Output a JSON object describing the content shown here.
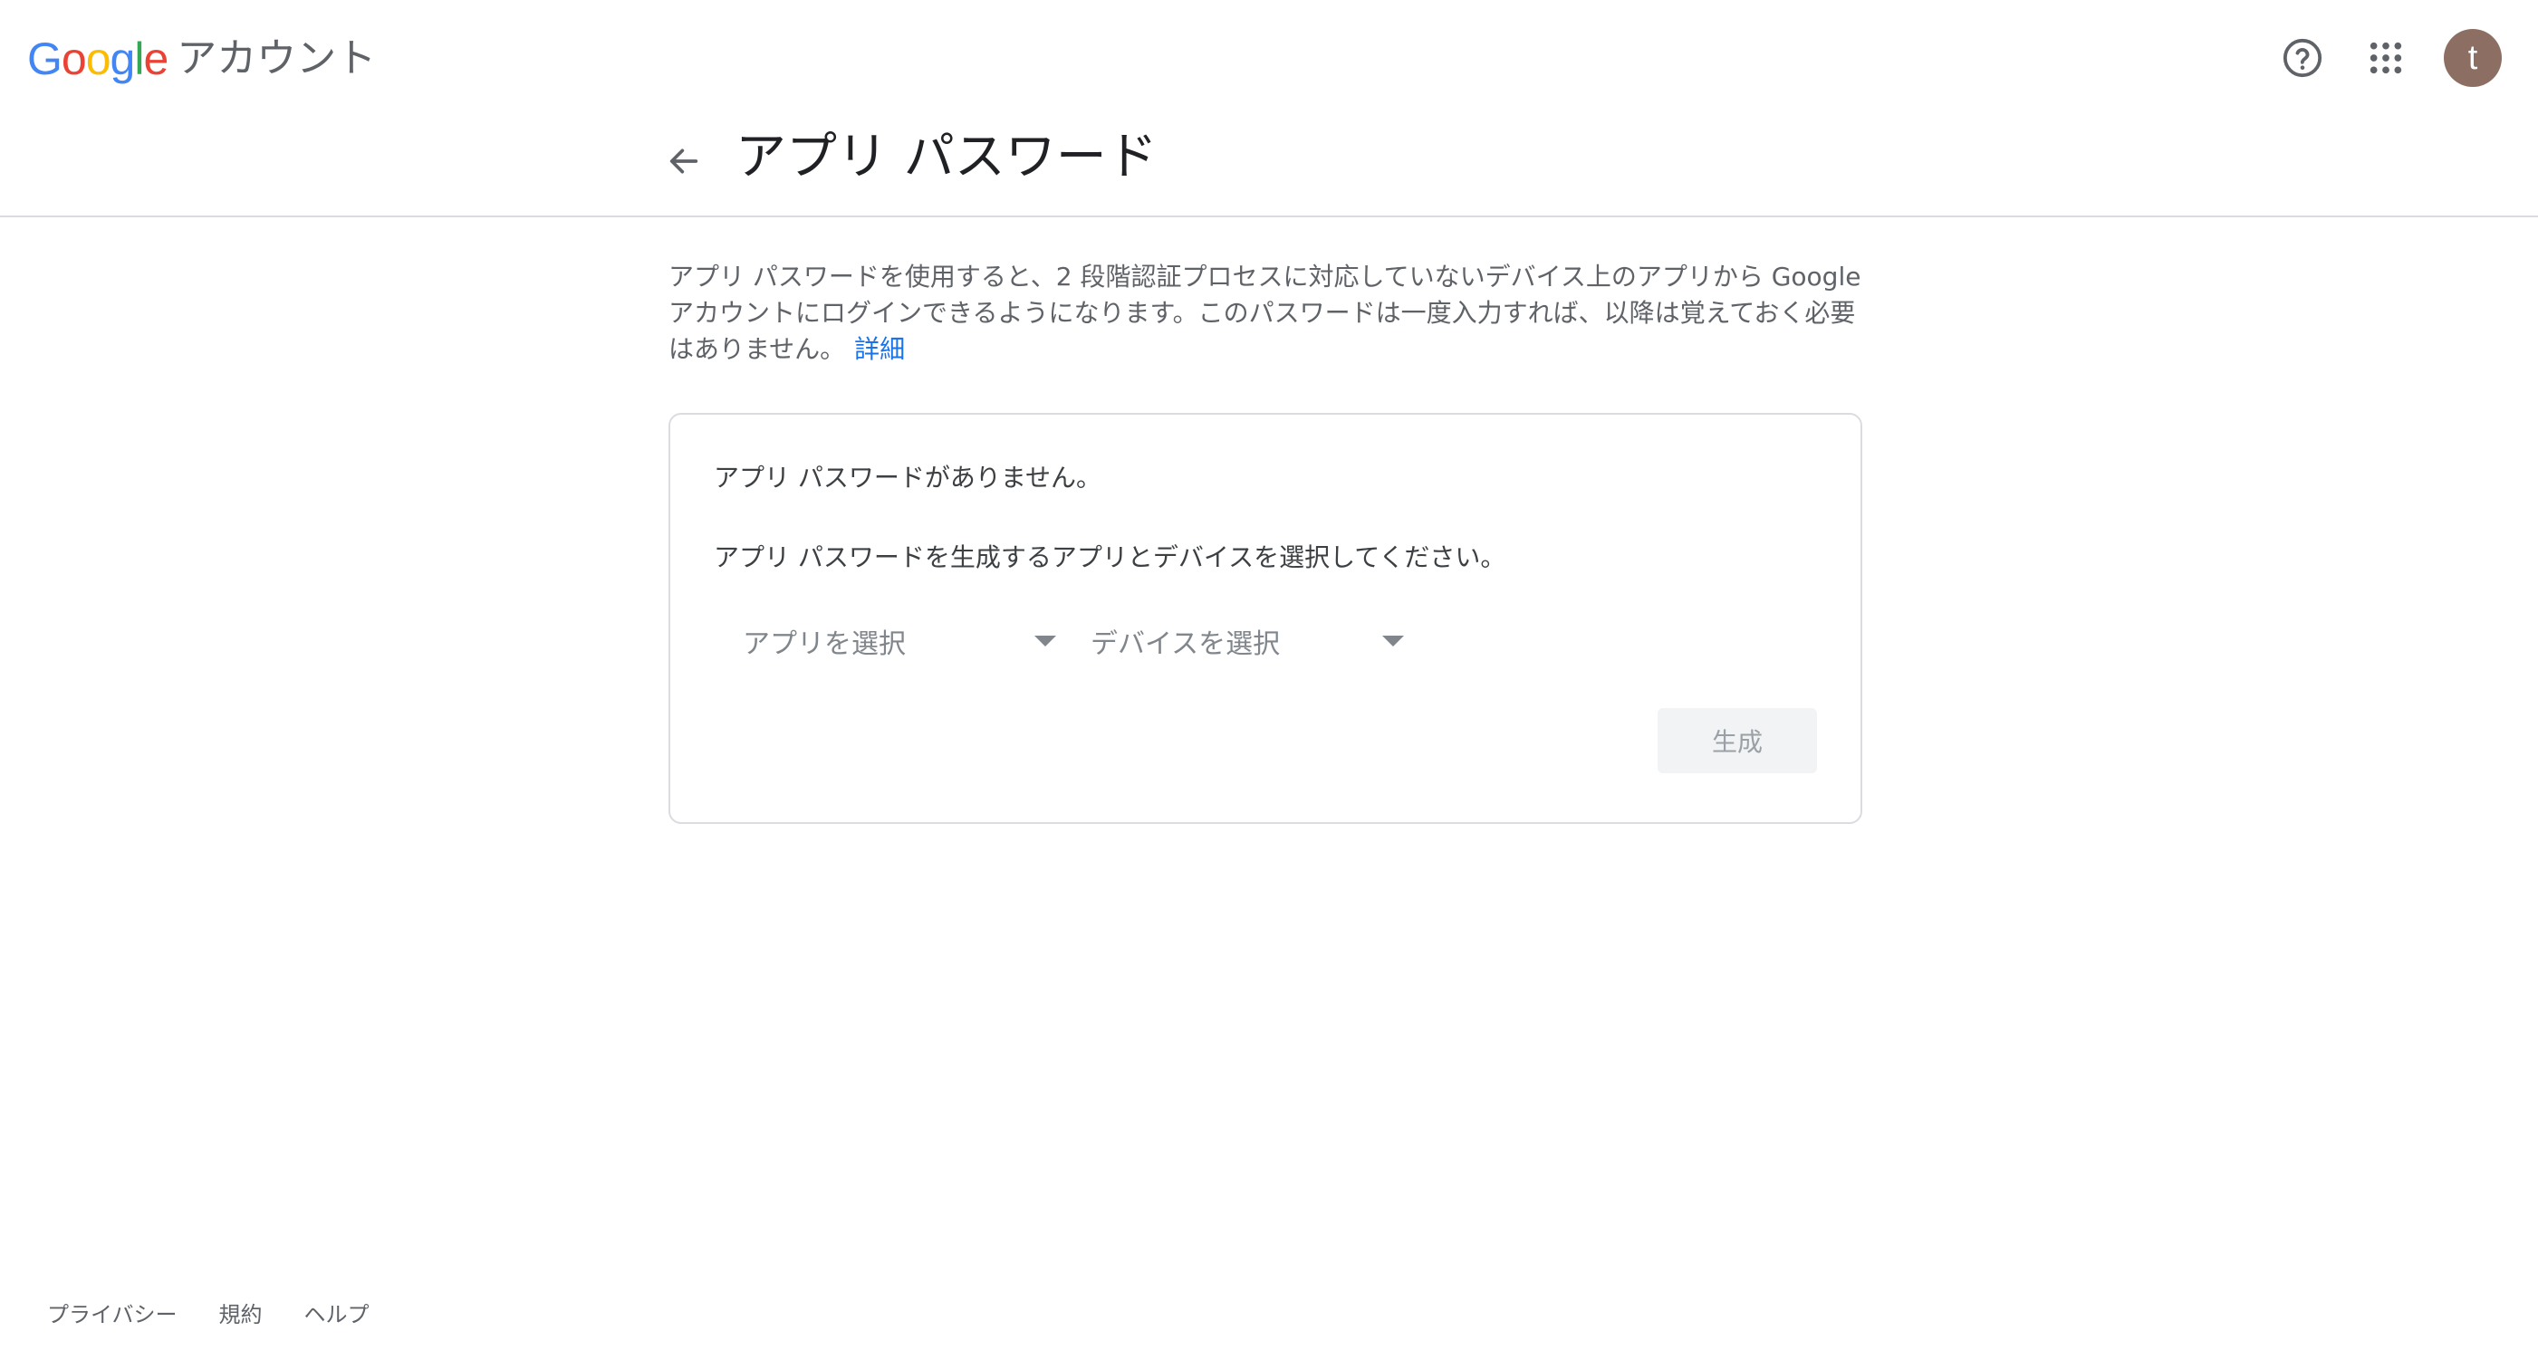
{
  "header": {
    "logo_parts": [
      {
        "text": "G",
        "color": "#4285F4"
      },
      {
        "text": "o",
        "color": "#EA4335"
      },
      {
        "text": "o",
        "color": "#FBBC05"
      },
      {
        "text": "g",
        "color": "#4285F4"
      },
      {
        "text": "l",
        "color": "#34A853"
      },
      {
        "text": "e",
        "color": "#EA4335"
      }
    ],
    "product": "アカウント",
    "help_icon": "help-circle-icon",
    "apps_icon": "apps-grid-icon",
    "avatar_initial": "t",
    "avatar_color": "#8d6e63"
  },
  "page": {
    "title": "アプリ パスワード",
    "back_icon": "arrow-back-icon",
    "description": "アプリ パスワードを使用すると、2 段階認証プロセスに対応していないデバイス上のアプリから Google アカウントにログインできるようになります。このパスワードは一度入力すれば、以降は覚えておく必要はありません。",
    "learn_more": "詳細"
  },
  "card": {
    "no_passwords": "アプリ パスワードがありません。",
    "instruction": "アプリ パスワードを生成するアプリとデバイスを選択してください。",
    "app_select": {
      "label": "アプリを選択"
    },
    "device_select": {
      "label": "デバイスを選択"
    },
    "generate_button": "生成"
  },
  "footer": {
    "links": [
      "プライバシー",
      "規約",
      "ヘルプ"
    ]
  },
  "colors": {
    "accent": "#1a73e8",
    "divider": "#dadce0"
  }
}
